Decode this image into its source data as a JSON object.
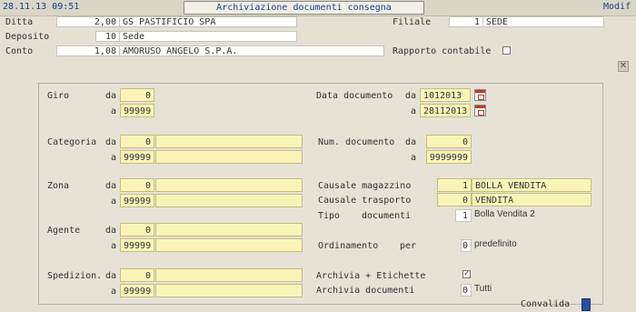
{
  "header": {
    "datetime": "28.11.13 09:51",
    "title": "Archiviazione documenti consegna",
    "mode": "Modif"
  },
  "top": {
    "ditta_label": "Ditta",
    "ditta_code": "2,00",
    "ditta_name": "GS PASTIFICIO SPA",
    "filiale_label": "Filiale",
    "filiale_code": "1",
    "filiale_name": "SEDE",
    "deposito_label": "Deposito",
    "deposito_code": "10",
    "deposito_name": "Sede",
    "conto_label": "Conto",
    "conto_code": "1,08",
    "conto_name": "AMORUSO ANGELO S.P.A.",
    "rapporto_label": "Rapporto contabile"
  },
  "left": {
    "da": "da",
    "a": "a",
    "giro_label": "Giro",
    "giro_da": "0",
    "giro_a": "99999",
    "categoria_label": "Categoria",
    "categoria_da": "0",
    "categoria_a": "99999",
    "zona_label": "Zona",
    "zona_da": "0",
    "zona_a": "99999",
    "agente_label": "Agente",
    "agente_da": "0",
    "agente_a": "99999",
    "spedizion_label": "Spedizion.",
    "spedizion_da": "0",
    "spedizion_a": "99999"
  },
  "right": {
    "data_doc_label": "Data documento",
    "data_da": "1012013",
    "data_a": "28112013",
    "num_doc_label": "Num. documento",
    "num_da": "0",
    "num_a": "9999999",
    "causale_mag_label": "Causale magazzino",
    "causale_mag_code": "1",
    "causale_mag_desc": "BOLLA VENDITA",
    "causale_tra_label": "Causale trasporto",
    "causale_tra_code": "0",
    "causale_tra_desc": "VENDITA",
    "tipo_label": "Tipo",
    "documenti_label": "documenti",
    "tipo_code": "1",
    "tipo_desc": "Bolla Vendita 2",
    "ordinamento_label": "Ordinamento",
    "per_label": "per",
    "ord_code": "0",
    "ord_desc": "predefinito",
    "archivia_etich_label": "Archivia + Etichette",
    "archivia_etich_check": "✓",
    "archivia_doc_label": "Archivia documenti",
    "archivia_doc_code": "0",
    "archivia_doc_desc": "Tutti"
  },
  "footer": {
    "convalida_label": "Convalida"
  },
  "colors": {
    "background": "#e4e1d4",
    "yellow_field": "#fbf4b9",
    "accent": "#1d3e8a"
  }
}
